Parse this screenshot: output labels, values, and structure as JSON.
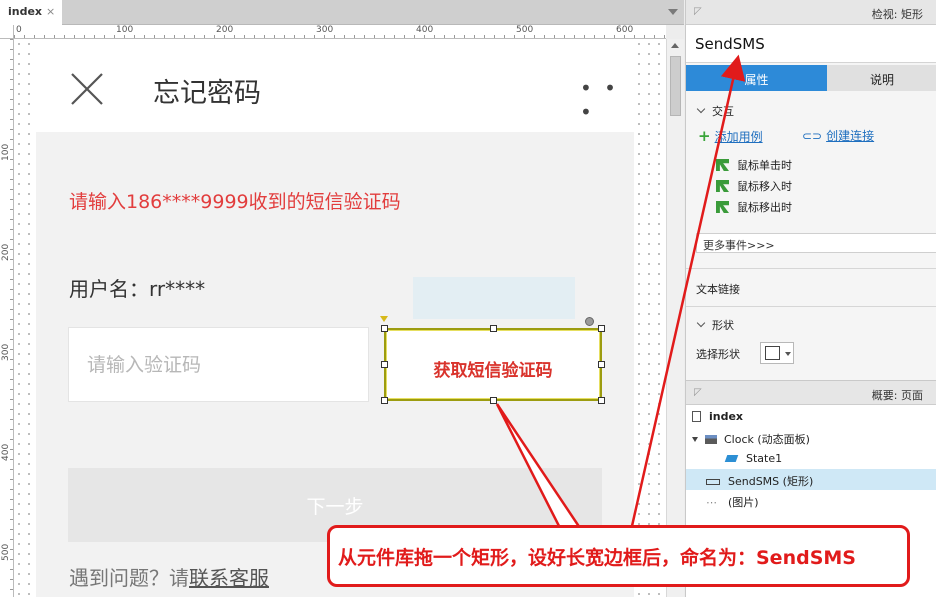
{
  "editor": {
    "tab_label": "index",
    "tab_close": "×",
    "ruler_top": [
      "0",
      "100",
      "200",
      "300",
      "400",
      "500",
      "600"
    ],
    "ruler_left": [
      "100",
      "200",
      "300",
      "400",
      "500"
    ]
  },
  "page": {
    "title": "忘记密码",
    "more": "• • •",
    "sms_hint": "请输入186****9999收到的短信验证码",
    "username": "用户名：rr****",
    "code_placeholder": "请输入验证码",
    "send_button": "获取短信验证码",
    "next_button": "下一步",
    "help_prefix": "遇到问题？请",
    "help_link": "联系客服"
  },
  "inspector": {
    "header": "检视: 矩形",
    "widget_name": "SendSMS",
    "tab_properties": "属性",
    "tab_notes": "说明",
    "interaction_section": "交互",
    "add_case": "添加用例",
    "create_link": "创建连接",
    "events": [
      "鼠标单击时",
      "鼠标移入时",
      "鼠标移出时"
    ],
    "more_events": "更多事件>>>",
    "text_link": "文本链接",
    "shape_section": "形状",
    "select_shape": "选择形状"
  },
  "outline": {
    "header": "概要: 页面",
    "items": {
      "index": "index",
      "clock": "Clock (动态面板)",
      "state1": "State1",
      "sendsms": "SendSMS (矩形)",
      "image": "(图片)"
    }
  },
  "annotation": {
    "text": "从元件库拖一个矩形，设好长宽边框后，命名为：SendSMS"
  },
  "colors": {
    "accent_blue": "#2d8ad8",
    "annotation_red": "#e11b1b",
    "hint_red": "#e23d3d",
    "selection_border": "#9c9c10"
  }
}
